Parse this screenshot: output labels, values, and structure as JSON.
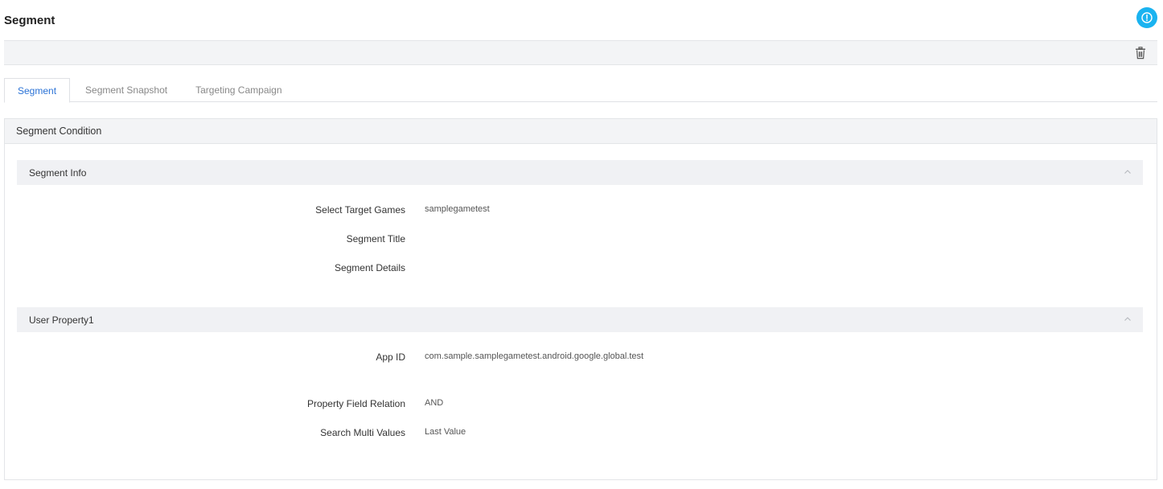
{
  "header": {
    "title": "Segment",
    "help_icon": "help-circle-icon",
    "help_color": "#1ab3f0"
  },
  "toolbar": {
    "delete_icon": "trash-icon"
  },
  "tabs": [
    {
      "label": "Segment",
      "active": true
    },
    {
      "label": "Segment Snapshot",
      "active": false
    },
    {
      "label": "Targeting Campaign",
      "active": false
    }
  ],
  "panel": {
    "title": "Segment Condition",
    "sections": [
      {
        "title": "Segment Info",
        "expanded": true,
        "fields": [
          {
            "label": "Select Target Games",
            "value": "samplegametest"
          },
          {
            "label": "Segment Title",
            "value": ""
          },
          {
            "label": "Segment Details",
            "value": ""
          }
        ]
      },
      {
        "title": "User Property1",
        "expanded": true,
        "fields": [
          {
            "label": "App ID",
            "value": "com.sample.samplegametest.android.google.global.test"
          },
          {
            "label": "Property Field Relation",
            "value": "AND"
          },
          {
            "label": "Search Multi Values",
            "value": "Last Value"
          }
        ]
      }
    ]
  },
  "colors": {
    "accent": "#2a72d6",
    "header_bg": "#f3f4f6"
  }
}
